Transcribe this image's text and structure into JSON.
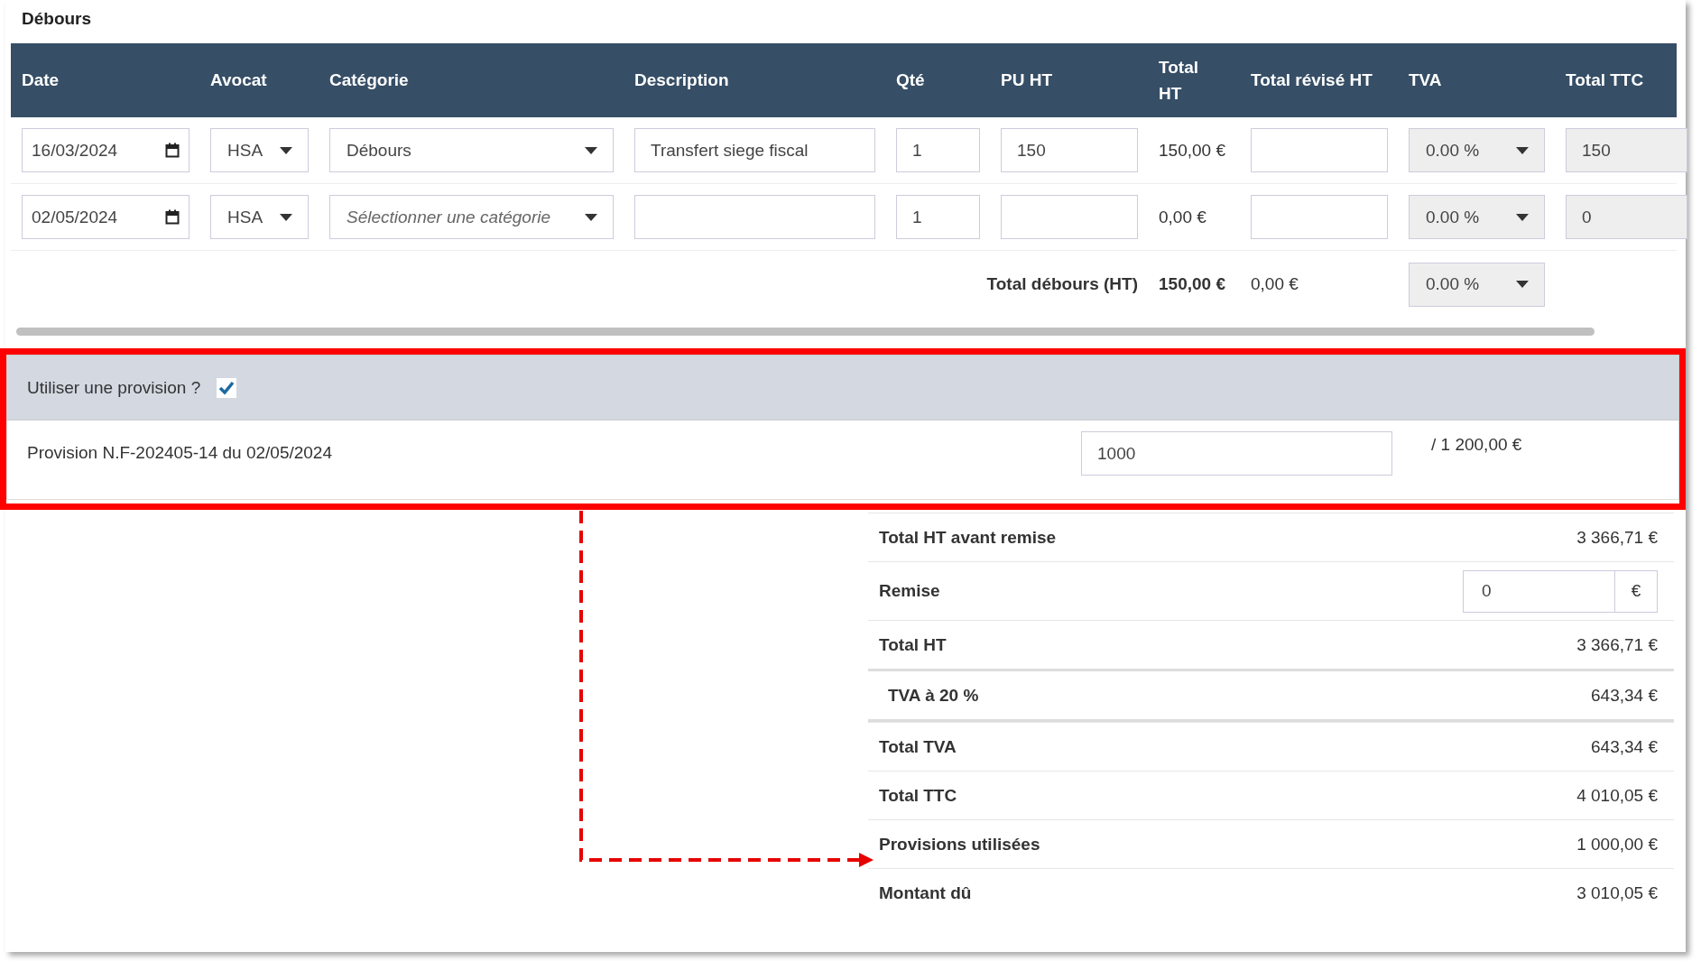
{
  "debours": {
    "title": "Débours",
    "columns": [
      "Date",
      "Avocat",
      "Catégorie",
      "Description",
      "Qté",
      "PU HT",
      "Total HT",
      "Total révisé HT",
      "TVA",
      "Total TTC"
    ],
    "rows": [
      {
        "date": "16/03/2024",
        "avocat": "HSA",
        "categorie": {
          "value": "Débours"
        },
        "description": "Transfert siege fiscal",
        "qte": "1",
        "pu_ht": "150",
        "total_ht": "150,00 €",
        "tva": "0.00 %",
        "total_ttc": "150"
      },
      {
        "date": "02/05/2024",
        "avocat": "HSA",
        "categorie": {
          "placeholder": "Sélectionner une catégorie"
        },
        "qte": "1",
        "total_ht": "0,00 €",
        "tva": "0.00 %",
        "total_ttc": "0"
      }
    ],
    "total": {
      "label": "Total débours (HT)",
      "total_ht": "150,00 €",
      "total_revise": "0,00 €",
      "tva": "0.00 %"
    }
  },
  "provision": {
    "highlighted": true,
    "label": "Utiliser une provision ?",
    "checked": true,
    "items": [
      {
        "label": "Provision N.F-202405-14 du 02/05/2024",
        "amount": "1000",
        "of_total": "/ 1 200,00 €"
      }
    ]
  },
  "totals": [
    {
      "kind": "line",
      "label": "Total HT avant remise",
      "value": "3 366,71 €"
    },
    {
      "kind": "field",
      "label": "Remise",
      "value": "0",
      "unit": "€"
    },
    {
      "kind": "line",
      "label": "Total HT",
      "value": "3 366,71 €"
    },
    {
      "kind": "tax",
      "label": "TVA à 20 %",
      "value": "643,34 €"
    },
    {
      "kind": "line",
      "label": "Total TVA",
      "value": "643,34 €"
    },
    {
      "kind": "line",
      "label": "Total TTC",
      "value": "4 010,05 €"
    },
    {
      "kind": "line",
      "label": "Provisions utilisées",
      "value": "1 000,00 €"
    },
    {
      "kind": "line",
      "label": "Montant dû",
      "value": "3 010,05 €"
    }
  ]
}
